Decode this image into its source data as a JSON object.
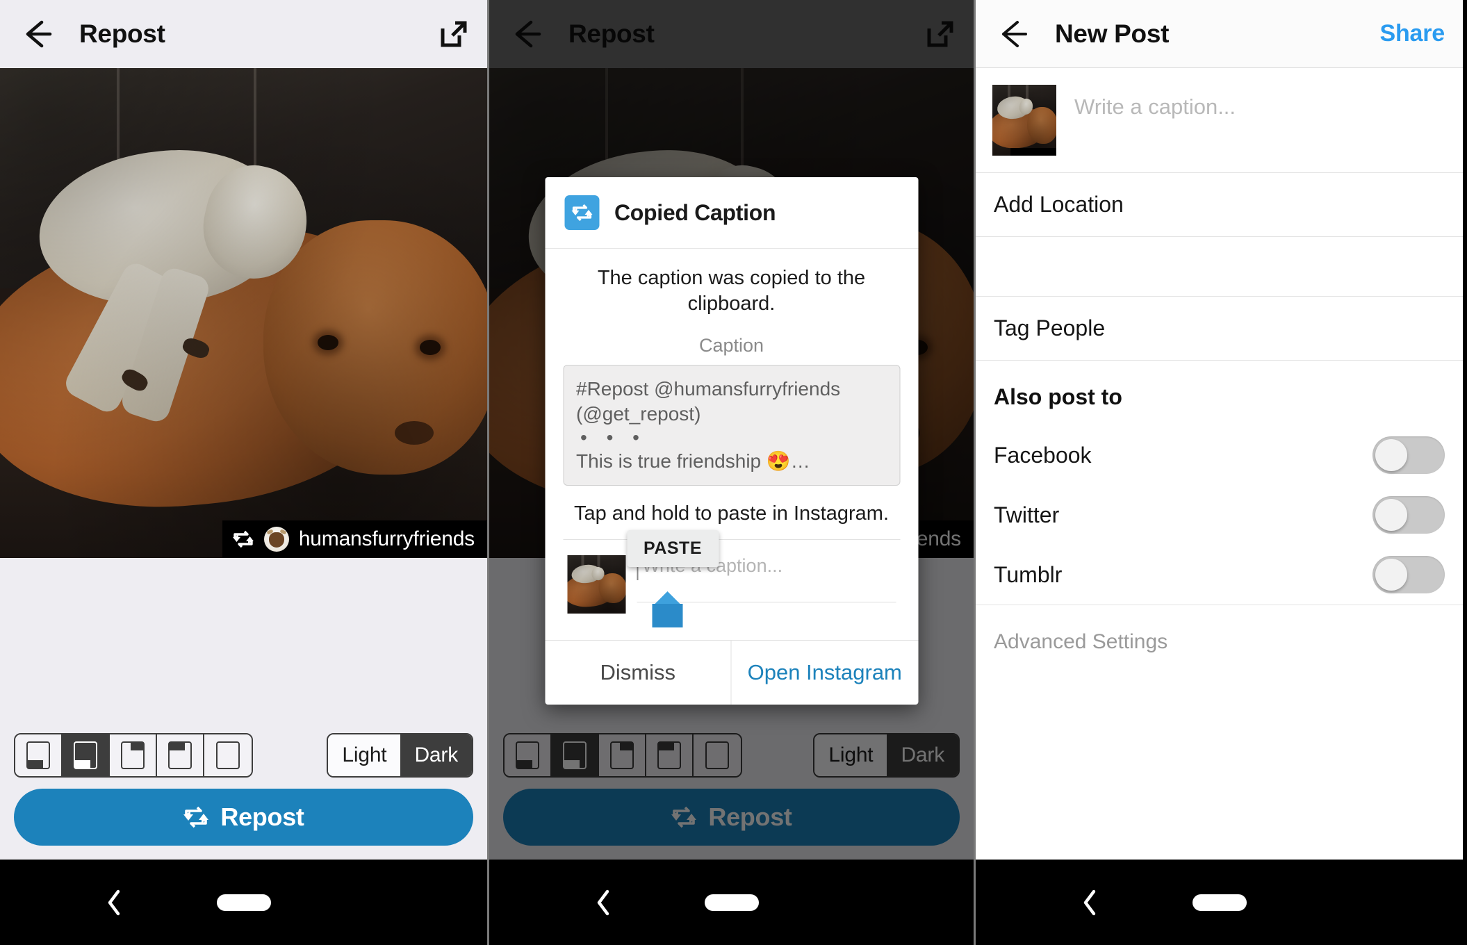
{
  "panel_repost_light": {
    "appbar": {
      "back_icon": "back-arrow-icon",
      "title": "Repost",
      "action_icon": "open-external-icon"
    },
    "photo": {
      "watermark": {
        "repost_icon": "repost-icon",
        "avatar_icon": "user-avatar-icon",
        "username": "humansfurryfriends"
      }
    },
    "toolbar": {
      "positions": [
        {
          "name": "position-bottom-left-dark",
          "badge": "bottom-left",
          "selected": false
        },
        {
          "name": "position-bottom-left-light",
          "badge": "bottom-left",
          "selected": true
        },
        {
          "name": "position-top-right",
          "badge": "top-right",
          "selected": false
        },
        {
          "name": "position-top-left",
          "badge": "top-left",
          "selected": false
        },
        {
          "name": "position-none",
          "badge": "none",
          "selected": false
        }
      ],
      "theme": {
        "light_label": "Light",
        "dark_label": "Dark",
        "selected": "Dark"
      },
      "repost_button": {
        "icon": "repost-icon",
        "label": "Repost"
      }
    }
  },
  "panel_repost_dialog": {
    "appbar": {
      "back_icon": "back-arrow-icon",
      "title": "Repost",
      "action_icon": "open-external-icon"
    },
    "dialog": {
      "icon": "repost-app-icon",
      "title": "Copied Caption",
      "message": "The caption was copied to the clipboard.",
      "caption_label": "Caption",
      "caption_lines": [
        "#Repost @humansfurryfriends",
        "(@get_repost)"
      ],
      "caption_dots": "• • •",
      "caption_last_line": "This is true friendship 😍…",
      "tap_hint": "Tap and hold to paste in Instagram.",
      "paste_tooltip": "PASTE",
      "demo_caption_placeholder": "Write a caption...",
      "actions": {
        "dismiss": "Dismiss",
        "open": "Open Instagram"
      }
    },
    "toolbar": {
      "positions": [
        {
          "name": "position-bottom-left-dark",
          "badge": "bottom-left",
          "selected": false
        },
        {
          "name": "position-bottom-left-light",
          "badge": "bottom-left",
          "selected": true
        },
        {
          "name": "position-top-right",
          "badge": "top-right",
          "selected": false
        },
        {
          "name": "position-top-left",
          "badge": "top-left",
          "selected": false
        },
        {
          "name": "position-none",
          "badge": "none",
          "selected": false
        }
      ],
      "theme": {
        "light_label": "Light",
        "dark_label": "Dark",
        "selected": "Dark"
      },
      "repost_button": {
        "icon": "repost-icon",
        "label": "Repost"
      }
    }
  },
  "panel_new_post": {
    "appbar": {
      "back_icon": "back-arrow-icon",
      "title": "New Post",
      "share_label": "Share"
    },
    "caption_row": {
      "thumbnail": "post-thumbnail",
      "placeholder": "Write a caption..."
    },
    "rows": [
      {
        "name": "add-location",
        "label": "Add Location"
      },
      {
        "name": "tag-people",
        "label": "Tag People"
      }
    ],
    "also_post_to": {
      "title": "Also post to",
      "services": [
        {
          "name": "facebook",
          "label": "Facebook",
          "enabled": false
        },
        {
          "name": "twitter",
          "label": "Twitter",
          "enabled": false
        },
        {
          "name": "tumblr",
          "label": "Tumblr",
          "enabled": false
        }
      ]
    },
    "advanced_settings": "Advanced Settings"
  },
  "navbar": {
    "back_icon": "nav-back-icon",
    "home_pill": "nav-home-pill"
  },
  "colors": {
    "accent_blue": "#1c82bb",
    "link_blue": "#2a9bf0",
    "appbar_light": "#eeedf2",
    "dark_selected": "#3d3d3d",
    "repost_icon_blue": "#3fa3e0"
  }
}
